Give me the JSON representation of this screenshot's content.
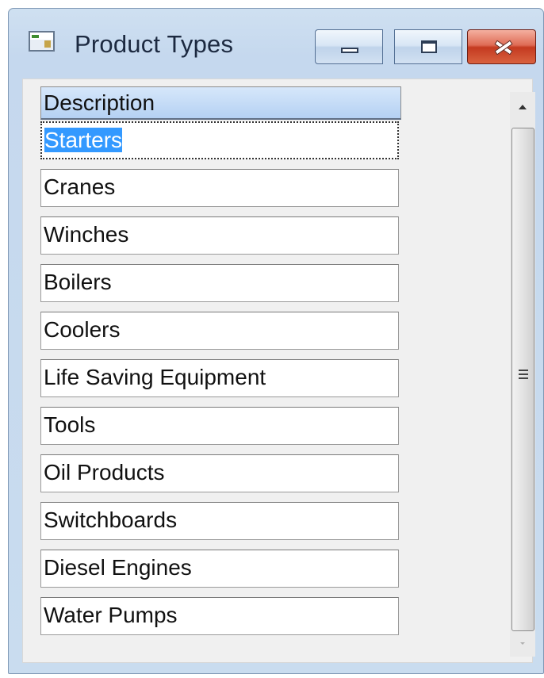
{
  "window": {
    "title": "Product Types",
    "icon": "application-window-icon",
    "controls": {
      "minimize": "minimize-icon",
      "maximize": "maximize-icon",
      "close": "close-icon"
    }
  },
  "grid": {
    "column_header": "Description",
    "rows": [
      "Starters",
      "Cranes",
      "Winches",
      "Boilers",
      "Coolers",
      "Life Saving Equipment",
      "Tools",
      "Oil Products",
      "Switchboards",
      "Diesel Engines",
      "Water Pumps"
    ],
    "selected_row": "Starters"
  },
  "colors": {
    "selection": "#3399ff",
    "header": "#b5d1f3",
    "close_button": "#c43a20"
  }
}
